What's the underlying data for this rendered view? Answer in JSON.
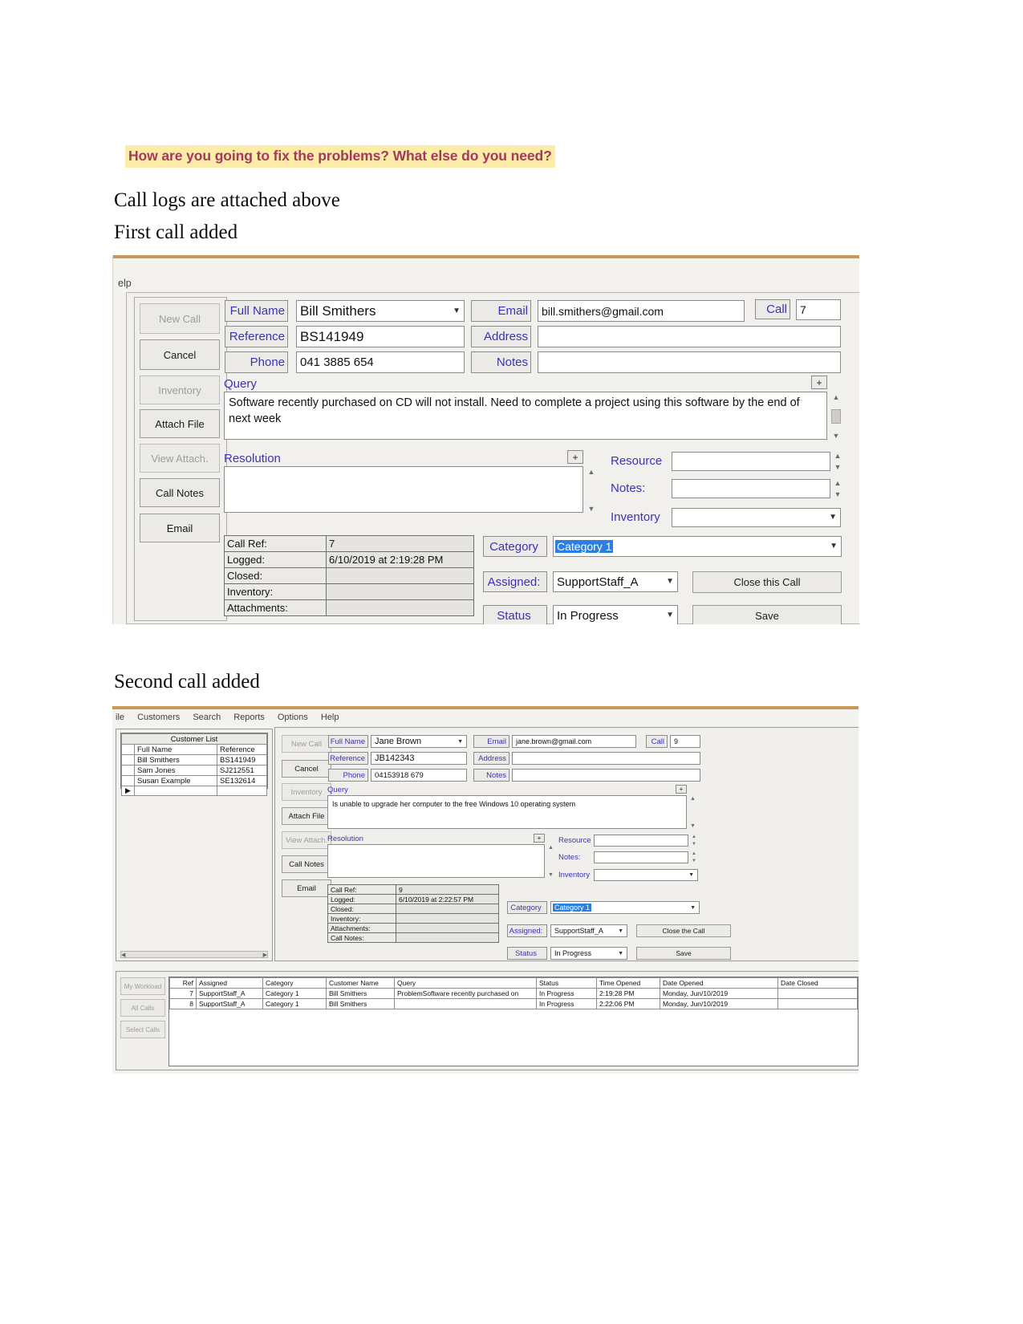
{
  "document": {
    "highlight_heading": "How are you going to fix the problems? What else do you need?",
    "line_1": "Call logs are attached above",
    "line_2": "First call added",
    "line_3": "Second call added"
  },
  "shot1": {
    "menu_fragment": "elp",
    "sidebar": [
      {
        "label": "New Call",
        "enabled": false
      },
      {
        "label": "Cancel",
        "enabled": true
      },
      {
        "label": "Inventory",
        "enabled": false
      },
      {
        "label": "Attach File",
        "enabled": true
      },
      {
        "label": "View Attach.",
        "enabled": false
      },
      {
        "label": "Call Notes",
        "enabled": true
      },
      {
        "label": "Email",
        "enabled": true
      }
    ],
    "fields": {
      "full_name_label": "Full Name",
      "full_name_value": "Bill Smithers",
      "reference_label": "Reference",
      "reference_value": "BS141949",
      "phone_label": "Phone",
      "phone_value": "041 3885 654",
      "email_label": "Email",
      "email_value": "bill.smithers@gmail.com",
      "address_label": "Address",
      "address_value": "",
      "notes_label": "Notes",
      "notes_value": "",
      "call_label": "Call",
      "call_value": "7"
    },
    "query_label": "Query",
    "query_value": "Software recently purchased on CD will not install. Need to complete a project using this software by the end of next week",
    "resolution_label": "Resolution",
    "resolution_value": "",
    "plus_label": "+",
    "right": {
      "resource_label": "Resource",
      "resource_value": "",
      "notes_label": "Notes:",
      "notes_value": "",
      "inventory_label": "Inventory",
      "inventory_value": ""
    },
    "info_table": [
      {
        "key": "Call Ref:",
        "value": "7"
      },
      {
        "key": "Logged:",
        "value": "6/10/2019  at  2:19:28 PM"
      },
      {
        "key": "Closed:",
        "value": ""
      },
      {
        "key": "Inventory:",
        "value": ""
      },
      {
        "key": "Attachments:",
        "value": ""
      }
    ],
    "category_label": "Category",
    "category_value": "Category 1",
    "assigned_label": "Assigned:",
    "assigned_value": "SupportStaff_A",
    "status_label": "Status",
    "status_value": "In Progress",
    "close_call_button": "Close this Call",
    "save_button": "Save"
  },
  "shot2": {
    "menu": [
      "ile",
      "Customers",
      "Search",
      "Reports",
      "Options",
      "Help"
    ],
    "customer_list": {
      "title": "Customer List",
      "columns": [
        "Full Name",
        "Reference"
      ],
      "rows": [
        {
          "full_name": "Bill Smithers",
          "reference": "BS141949"
        },
        {
          "full_name": "Sam Jones",
          "reference": "SJ212551"
        },
        {
          "full_name": "Susan Example",
          "reference": "SE132614"
        }
      ]
    },
    "sidebar": [
      {
        "label": "New Call",
        "enabled": false
      },
      {
        "label": "Cancel",
        "enabled": true
      },
      {
        "label": "Inventory",
        "enabled": false
      },
      {
        "label": "Attach File",
        "enabled": true
      },
      {
        "label": "View Attach.",
        "enabled": false
      },
      {
        "label": "Call Notes",
        "enabled": true
      },
      {
        "label": "Email",
        "enabled": true
      }
    ],
    "fields": {
      "full_name_label": "Full Name",
      "full_name_value": "Jane Brown",
      "reference_label": "Reference",
      "reference_value": "JB142343",
      "phone_label": "Phone",
      "phone_value": "04153918 679",
      "email_label": "Email",
      "email_value": "jane.brown@gmail.com",
      "address_label": "Address",
      "address_value": "",
      "notes_label": "Notes",
      "notes_value": "",
      "call_label": "Call",
      "call_value": "9"
    },
    "query_label": "Query",
    "query_value": "Is unable to upgrade her computer to the free Windows 10 operating system",
    "resolution_label": "Resolution",
    "resolution_value": "",
    "plus_label": "+",
    "right": {
      "resource_label": "Resource",
      "resource_value": "",
      "notes_label": "Notes:",
      "notes_value": "",
      "inventory_label": "Inventory",
      "inventory_value": ""
    },
    "info_table": [
      {
        "key": "Call Ref:",
        "value": "9"
      },
      {
        "key": "Logged:",
        "value": "6/10/2019  at 2:22:57 PM"
      },
      {
        "key": "Closed:",
        "value": ""
      },
      {
        "key": "Inventory:",
        "value": ""
      },
      {
        "key": "Attachments:",
        "value": ""
      },
      {
        "key": "Call Notes:",
        "value": ""
      }
    ],
    "category_label": "Category",
    "category_value": "Category 1",
    "assigned_label": "Assigned:",
    "assigned_value": "SupportStaff_A",
    "status_label": "Status",
    "status_value": "In Progress",
    "close_call_button": "Close the Call",
    "save_button": "Save",
    "bottom_tabs": [
      "My Workload",
      "All Calls",
      "Select Calls"
    ],
    "calls_grid": {
      "columns": [
        "Ref",
        "Assigned",
        "Category",
        "Customer Name",
        "Query",
        "Status",
        "Time Opened",
        "Date Opened",
        "Date Closed"
      ],
      "rows": [
        {
          "ref": "7",
          "assigned": "SupportStaff_A",
          "category": "Category 1",
          "customer_name": "Bill Smithers",
          "query": "ProblemSoftware recently purchased on",
          "status": "In Progress",
          "time_opened": "2:19:28 PM",
          "date_opened": "Monday, Jun/10/2019",
          "date_closed": ""
        },
        {
          "ref": "8",
          "assigned": "SupportStaff_A",
          "category": "Category 1",
          "customer_name": "Bill Smithers",
          "query": "",
          "status": "In Progress",
          "time_opened": "2:22:06 PM",
          "date_opened": "Monday, Jun/10/2019",
          "date_closed": ""
        }
      ]
    }
  },
  "colors": {
    "highlight_bg": "#fdeba8",
    "highlight_fg": "#a33a5b",
    "label_fg": "#3a33b5",
    "selection_bg": "#2a7fe0",
    "window_chrome": "#c79a55"
  }
}
